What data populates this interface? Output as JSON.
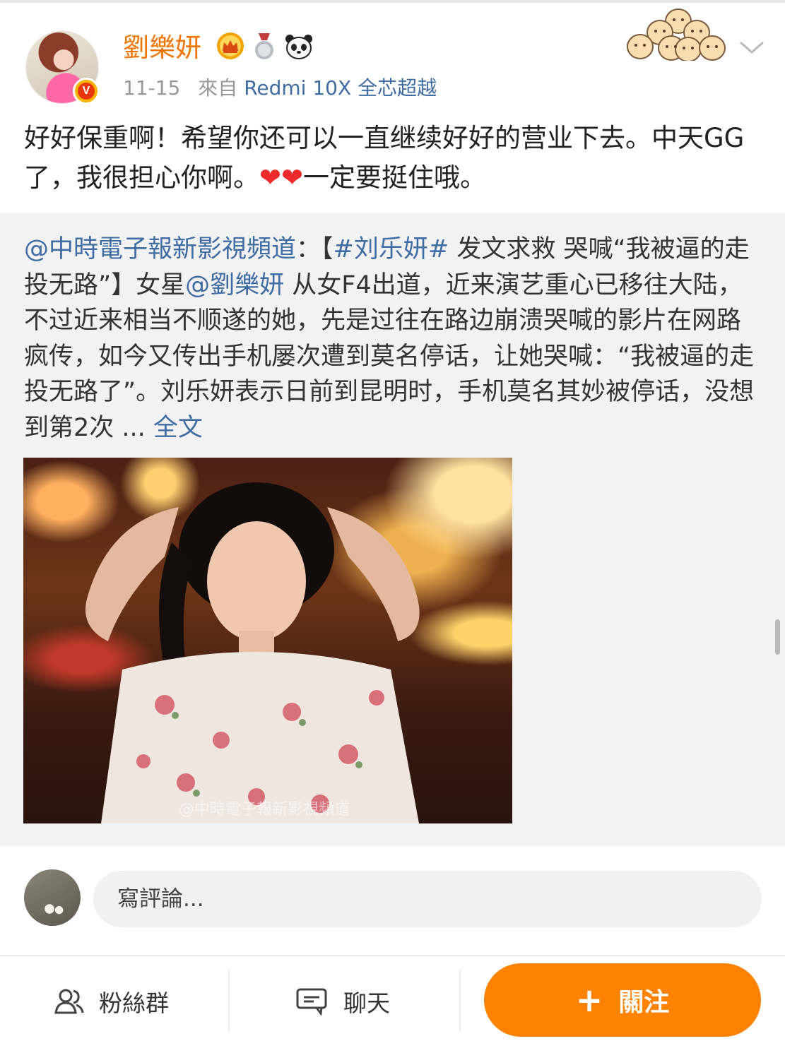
{
  "post": {
    "username": "劉樂妍",
    "date": "11-15",
    "source_prefix": "來自",
    "source_device": "Redmi 10X 全芯超越",
    "verified_mark": "V",
    "text_part1": "好好保重啊！希望你还可以一直继续好好的营业下去。中天GG了，我很担心你啊。",
    "hearts": "❤❤",
    "text_part2": "一定要挺住哦。"
  },
  "repost": {
    "mention": "@中時電子報新影視頻道",
    "colon": "：【",
    "hashtag": "#刘乐妍#",
    "text1": " 发文求救 哭喊“我被逼的走投无路”】女星",
    "mention2": "@劉樂妍",
    "text2": " 从女F4出道，近来演艺重心已移往大陆，不过近来相当不顺遂的她，先是过往在路边崩溃哭喊的影片在网路疯传，如今又传出手机屡次遭到莫名停话，让她哭喊：“我被逼的走投无路了”。刘乐妍表示日前到昆明时，手机莫名其妙被停话，没想到第2次 ... ",
    "full_text_link": "全文",
    "image_watermark": "@中時電子報新影視頻道"
  },
  "comment": {
    "placeholder": "寫評論..."
  },
  "bottom_bar": {
    "fans_group_label": "粉絲群",
    "chat_label": "聊天",
    "follow_label": "關注",
    "follow_plus": "+"
  },
  "colors": {
    "brand_orange": "#ff8200",
    "username_orange": "#ef7500",
    "link_blue": "#3f6da3",
    "heart_red": "#ee2a2a"
  },
  "icons": [
    "crown-badge-icon",
    "medal-badge-icon",
    "panda-badge-icon",
    "chevron-down-icon",
    "fans-group-icon",
    "chat-icon",
    "sticker-decoration"
  ]
}
